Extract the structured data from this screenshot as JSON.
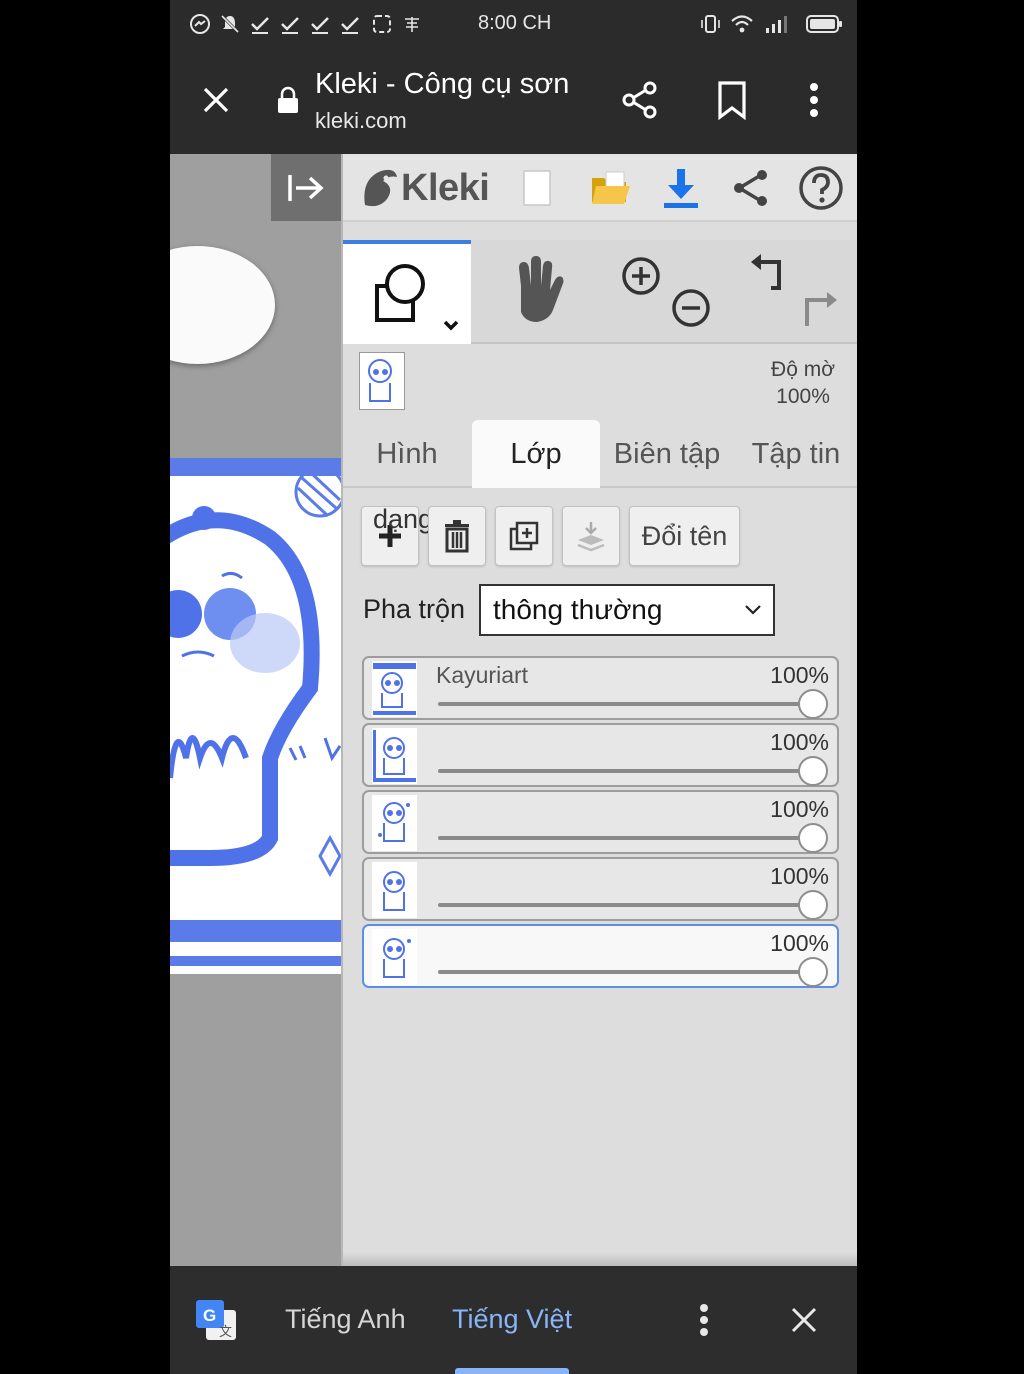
{
  "status_bar": {
    "time": "8:00 CH",
    "left_icons": [
      "messenger-icon",
      "mute-icon",
      "check-icon",
      "check-icon",
      "check-icon",
      "check-icon",
      "screenshot-icon",
      "app-icon"
    ],
    "right_icons": [
      "vibrate-icon",
      "wifi-icon",
      "signal-icon",
      "battery-icon"
    ]
  },
  "browser": {
    "page_title": "Kleki - Công cụ sơn",
    "url": "kleki.com",
    "buttons": [
      "close-icon",
      "share-icon",
      "bookmark-icon",
      "more-icon"
    ]
  },
  "kleki": {
    "logo_text": "Kleki",
    "top_buttons": [
      "new-image-icon",
      "open-folder-icon",
      "download-icon",
      "share-icon",
      "help-icon"
    ],
    "opacity_label": "Độ mờ",
    "opacity_value": "100%",
    "tabs": [
      {
        "label": "Hình",
        "active": false
      },
      {
        "label": "Lớp",
        "active": true
      },
      {
        "label": "Biên tập",
        "active": false
      },
      {
        "label": "Tập tin",
        "active": false
      }
    ],
    "layer_buttons": {
      "add_label": "dạng",
      "rename_label": "Đổi tên"
    },
    "blend": {
      "label": "Pha trộn",
      "value": "thông thường"
    },
    "layers": [
      {
        "name": "Kayuriart",
        "opacity": "100%",
        "opacity_value": 1.0,
        "selected": false
      },
      {
        "name": "",
        "opacity": "100%",
        "opacity_value": 1.0,
        "selected": false
      },
      {
        "name": "",
        "opacity": "100%",
        "opacity_value": 1.0,
        "selected": false
      },
      {
        "name": "",
        "opacity": "100%",
        "opacity_value": 1.0,
        "selected": false
      },
      {
        "name": "",
        "opacity": "100%",
        "opacity_value": 1.0,
        "selected": true
      }
    ]
  },
  "translate_bar": {
    "source_lang": "Tiếng Anh",
    "target_lang": "Tiếng Việt",
    "icons": [
      "google-translate-icon",
      "more-icon",
      "close-icon"
    ]
  },
  "colors": {
    "accent_blue": "#3d7fe0",
    "translate_active": "#8ab4f8",
    "drawing_blue": "#4f72e8"
  }
}
